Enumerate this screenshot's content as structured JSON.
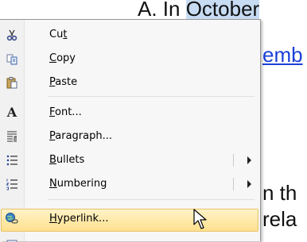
{
  "document": {
    "line1_prefix": "A. In ",
    "line1_selected": "October",
    "line2_link": "emb",
    "line3": "n th",
    "line4": "rela"
  },
  "menu": {
    "items": [
      {
        "key": "cut",
        "label": "Cut",
        "underline_char": "t",
        "icon": "scissors-icon"
      },
      {
        "key": "copy",
        "label": "Copy",
        "underline_char": "C",
        "icon": "copy-icon"
      },
      {
        "key": "paste",
        "label": "Paste",
        "underline_char": "P",
        "icon": "paste-icon"
      },
      {
        "key": "font",
        "label": "Font...",
        "underline_char": "F",
        "icon": "font-icon"
      },
      {
        "key": "paragraph",
        "label": "Paragraph...",
        "underline_char": "P",
        "icon": "paragraph-icon"
      },
      {
        "key": "bullets",
        "label": "Bullets",
        "underline_char": "B",
        "icon": "bullets-icon",
        "submenu": true
      },
      {
        "key": "numbering",
        "label": "Numbering",
        "underline_char": "N",
        "icon": "numbering-icon",
        "submenu": true
      },
      {
        "key": "hyperlink",
        "label": "Hyperlink...",
        "underline_char": "H",
        "icon": "hyperlink-icon",
        "hovered": true
      }
    ]
  },
  "colors": {
    "hover_fill": "#ffe08d",
    "hover_border": "#e8c26a",
    "menu_bg": "#f7f7f7",
    "link": "#1a3fd6",
    "selection": "#c7dcf3"
  }
}
